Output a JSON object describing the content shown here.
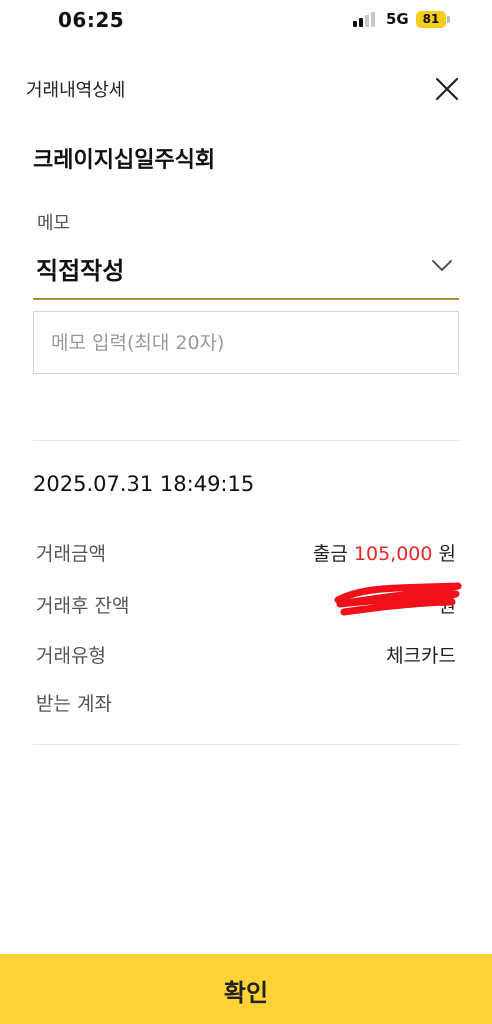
{
  "status_bar": {
    "time": "06:25",
    "network": "5G",
    "battery": "81"
  },
  "header": {
    "title": "거래내역상세"
  },
  "merchant_name": "크레이지십일주식회",
  "memo": {
    "label": "메모",
    "selected_option": "직접작성",
    "input_placeholder": "메모 입력(최대 20자)"
  },
  "transaction": {
    "datetime": "2025.07.31 18:49:15",
    "amount": {
      "label": "거래금액",
      "type": "출금",
      "value": "105,000",
      "currency": "원"
    },
    "balance": {
      "label": "거래후 잔액",
      "value": "원"
    },
    "kind": {
      "label": "거래유형",
      "value": "체크카드"
    },
    "receiving_account": {
      "label": "받는 계좌",
      "value": ""
    }
  },
  "footer": {
    "confirm_label": "확인"
  },
  "colors": {
    "accent_yellow": "#fdd337",
    "amount_red": "#e8262a",
    "underline_gold": "#b08a3e",
    "battery_yellow": "#f3cd1e"
  }
}
